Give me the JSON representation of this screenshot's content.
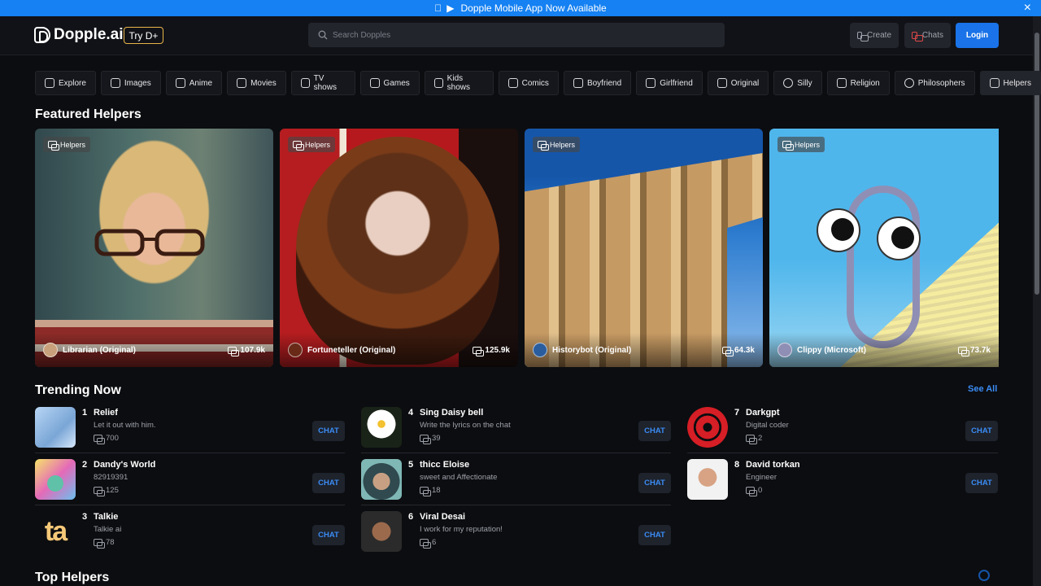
{
  "banner": {
    "text": "Dopple Mobile App Now Available",
    "close": "×"
  },
  "header": {
    "logo": "Dopple.ai",
    "try_label": "Try D+",
    "search_placeholder": "Search Dopples",
    "create_label": "Create",
    "chats_label": "Chats",
    "login_label": "Login"
  },
  "categories": [
    {
      "label": "Explore",
      "icon": "rocket-icon"
    },
    {
      "label": "Images",
      "icon": "camera-icon"
    },
    {
      "label": "Anime",
      "icon": "anime-icon"
    },
    {
      "label": "Movies",
      "icon": "popcorn-icon"
    },
    {
      "label": "TV shows",
      "icon": "tv-icon"
    },
    {
      "label": "Games",
      "icon": "gamepad-icon"
    },
    {
      "label": "Kids shows",
      "icon": "kids-tv-icon"
    },
    {
      "label": "Comics",
      "icon": "comic-icon"
    },
    {
      "label": "Boyfriend",
      "icon": "boyfriend-icon"
    },
    {
      "label": "Girlfriend",
      "icon": "girlfriend-icon"
    },
    {
      "label": "Original",
      "icon": "building-icon"
    },
    {
      "label": "Silly",
      "icon": "smile-icon"
    },
    {
      "label": "Religion",
      "icon": "religion-icon"
    },
    {
      "label": "Philosophers",
      "icon": "brain-icon"
    },
    {
      "label": "Helpers",
      "icon": "helpers-icon"
    }
  ],
  "featured": {
    "title": "Featured Helpers",
    "cards": [
      {
        "tag": "Helpers",
        "name": "Librarian (Original)",
        "count": "107.9k"
      },
      {
        "tag": "Helpers",
        "name": "Fortuneteller (Original)",
        "count": "125.9k"
      },
      {
        "tag": "Helpers",
        "name": "Historybot (Original)",
        "count": "64.3k"
      },
      {
        "tag": "Helpers",
        "name": "Clippy (Microsoft)",
        "count": "73.7k"
      }
    ]
  },
  "trending": {
    "title": "Trending Now",
    "see_all": "See All",
    "chat_label": "CHAT",
    "items": [
      {
        "rank": "1",
        "name": "Relief",
        "desc": "Let it out with him.",
        "count": "700"
      },
      {
        "rank": "2",
        "name": "Dandy's World",
        "desc": "82919391",
        "count": "125"
      },
      {
        "rank": "3",
        "name": "Talkie",
        "desc": "Talkie ai",
        "count": "78",
        "thumb_text": "ta"
      },
      {
        "rank": "4",
        "name": "Sing Daisy bell",
        "desc": "Write the lyrics on the chat",
        "count": "39"
      },
      {
        "rank": "5",
        "name": "thicc Eloise",
        "desc": "sweet and Affectionate",
        "count": "18"
      },
      {
        "rank": "6",
        "name": "Viral Desai",
        "desc": "I work for my reputation!",
        "count": "6"
      },
      {
        "rank": "7",
        "name": "Darkgpt",
        "desc": "Digital coder",
        "count": "2"
      },
      {
        "rank": "8",
        "name": "David torkan",
        "desc": "Engineer",
        "count": "0"
      }
    ]
  },
  "top": {
    "title": "Top Helpers"
  },
  "colors": {
    "accent": "#1a73e8",
    "banner": "#1581f2",
    "link": "#3b8cf5",
    "background": "#0c0d10",
    "try_border": "#e7b54a"
  }
}
